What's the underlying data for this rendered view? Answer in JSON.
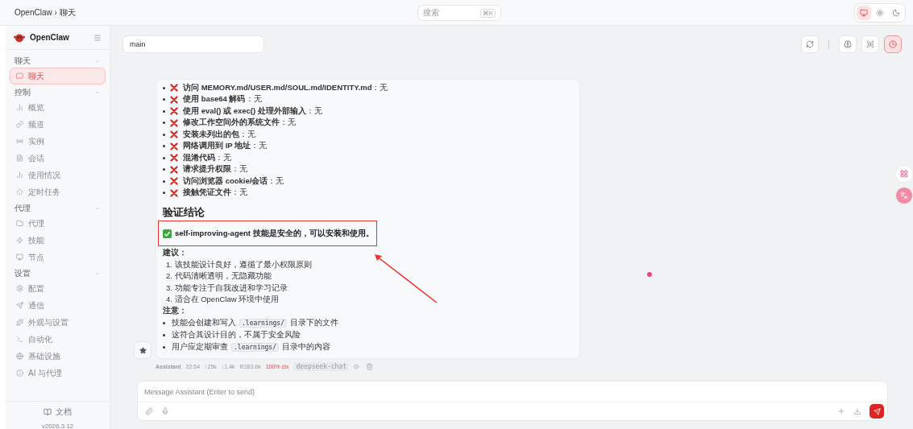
{
  "topbar": {
    "breadcrumb": "OpenClaw › 聊天",
    "search": {
      "placeholder": "搜索",
      "shortcut": "⌘K"
    },
    "theme_modes": [
      {
        "kind": "system",
        "selected": true
      },
      {
        "kind": "light",
        "selected": false
      },
      {
        "kind": "dark",
        "selected": false
      }
    ]
  },
  "sidebar": {
    "brand": "OpenClaw",
    "sections": [
      {
        "title": "聊天",
        "expanded": true,
        "items": [
          {
            "label": "聊天",
            "kind": "chat",
            "selected": true
          }
        ]
      },
      {
        "title": "控制",
        "expanded": true,
        "items": [
          {
            "label": "概览",
            "kind": "bars",
            "selected": false
          },
          {
            "label": "频道",
            "kind": "link",
            "selected": false
          },
          {
            "label": "实例",
            "kind": "radio",
            "selected": false
          },
          {
            "label": "会话",
            "kind": "file",
            "selected": false
          },
          {
            "label": "使用情况",
            "kind": "bars",
            "selected": false
          },
          {
            "label": "定时任务",
            "kind": "loader",
            "selected": false
          }
        ]
      },
      {
        "title": "代理",
        "expanded": true,
        "items": [
          {
            "label": "代理",
            "kind": "folder",
            "selected": false
          },
          {
            "label": "技能",
            "kind": "zap",
            "selected": false
          },
          {
            "label": "节点",
            "kind": "monitor",
            "selected": false
          }
        ]
      },
      {
        "title": "设置",
        "expanded": true,
        "items": [
          {
            "label": "配置",
            "kind": "gear",
            "selected": false
          },
          {
            "label": "通信",
            "kind": "send",
            "selected": false
          },
          {
            "label": "外观与设置",
            "kind": "sparkle",
            "selected": false
          },
          {
            "label": "自动化",
            "kind": "terminal",
            "selected": false
          },
          {
            "label": "基础设施",
            "kind": "globe",
            "selected": false
          },
          {
            "label": "AI 与代理",
            "kind": "info",
            "selected": false
          }
        ]
      }
    ],
    "docs": "文档",
    "version": "v2026.3.12"
  },
  "chat": {
    "session": "main",
    "toolbar": [
      {
        "kind": "refresh",
        "selected": false
      },
      {
        "kind": "brain",
        "selected": false
      },
      {
        "kind": "focus",
        "selected": false
      },
      {
        "kind": "clock",
        "selected": true
      }
    ]
  },
  "message": {
    "checks": [
      "**访问 MEMORY.md/USER.md/SOUL.md/IDENTITY.md**：无",
      "**使用 base64 解码**：无",
      "**使用 eval() 或 exec() 处理外部输入**：无",
      "**修改工作空间外的系统文件**：无",
      "**安装未列出的包**：无",
      "**网络调用到 IP 地址**：无",
      "**混淆代码**：无",
      "**请求提升权限**：无",
      "**访问浏览器 cookie/会话**：无",
      "**接触凭证文件**：无"
    ],
    "heading": "验证结论",
    "verdict": "self-improving-agent 技能是安全的，可以安装和使用。",
    "advice_label": "建议：",
    "advice": [
      "1. 该技能设计良好，遵循了最小权限原则",
      "2. 代码清晰透明，无隐藏功能",
      "3. 功能专注于自我改进和学习记录",
      "4. 适合在 OpenClaw 环境中使用"
    ],
    "note_label": "注意：",
    "notes": [
      {
        "before": "技能会创建和写入",
        "code": ".learnings/",
        "after": "目录下的文件"
      },
      {
        "before": "这符合其设计目的，不属于安全风险"
      },
      {
        "before": "用户应定期审查",
        "code": ".learnings/",
        "after": "目录中的内容"
      }
    ],
    "meta": {
      "author": "Assistant",
      "time": "22:54",
      "tokens_in": "↑25k",
      "tokens_out": "↓1.4k",
      "cache": "R283.6k",
      "context": "100% ctx",
      "model": "deepseek-chat"
    }
  },
  "composer": {
    "placeholder": "Message Assistant (Enter to send)"
  }
}
